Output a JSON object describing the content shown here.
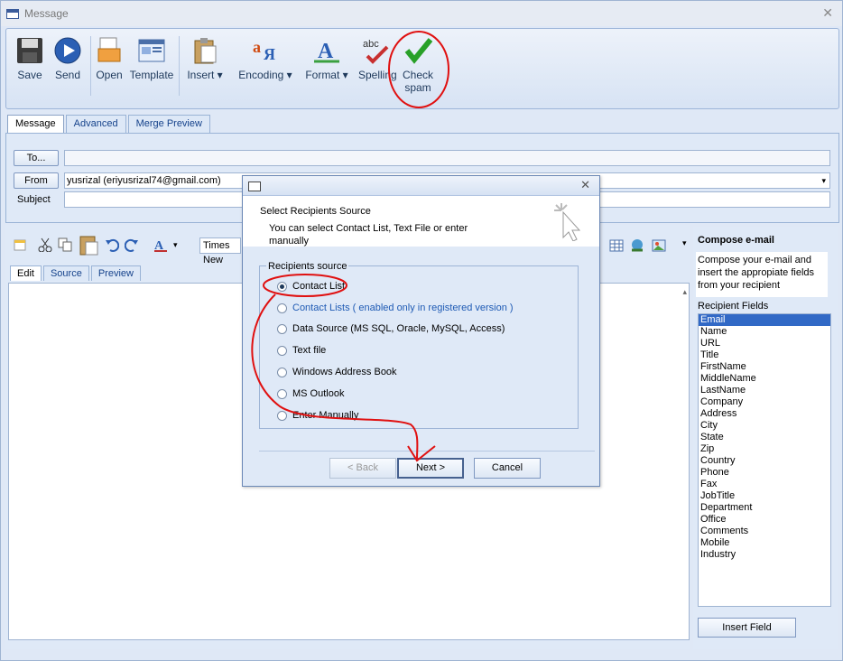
{
  "window": {
    "title": "Message",
    "close": "✕"
  },
  "ribbon": {
    "buttons": [
      {
        "label": "Save"
      },
      {
        "label": "Send"
      },
      {
        "label": "Open"
      },
      {
        "label": "Template"
      },
      {
        "label": "Insert ▾"
      },
      {
        "label": "Encoding ▾"
      },
      {
        "label": "Format ▾"
      },
      {
        "label": "Spelling"
      },
      {
        "label": "Check\nspam"
      }
    ]
  },
  "tabs": [
    "Message",
    "Advanced",
    "Merge Preview"
  ],
  "header": {
    "to_button": "To...",
    "to_value": "",
    "from_button": "From",
    "from_value": "yusrizal (eriyusrizal74@gmail.com)",
    "subject_label": "Subject",
    "subject_value": ""
  },
  "editor": {
    "font_name": "Times New",
    "tabs": [
      "Edit",
      "Source",
      "Preview"
    ]
  },
  "side": {
    "title": "Compose e-mail",
    "description": "Compose your e-mail and insert the appropiate fields from your recipient",
    "fields_label": "Recipient Fields",
    "fields": [
      "Email",
      "Name",
      "URL",
      "Title",
      "FirstName",
      "MiddleName",
      "LastName",
      "Company",
      "Address",
      "City",
      "State",
      "Zip",
      "Country",
      "Phone",
      "Fax",
      "JobTitle",
      "Department",
      "Office",
      "Comments",
      "Mobile",
      "Industry"
    ],
    "insert_button": "Insert Field"
  },
  "dialog": {
    "close": "✕",
    "heading": "Select Recipients Source",
    "subheading": "You can select Contact List, Text File or enter manually",
    "group_label": "Recipients source",
    "options": [
      {
        "label": "Contact List",
        "selected": true
      },
      {
        "label": "Contact Lists ( enabled only in registered version )",
        "selected": false
      },
      {
        "label": "Data Source (MS SQL, Oracle, MySQL, Access)",
        "selected": false
      },
      {
        "label": "Text file",
        "selected": false
      },
      {
        "label": "Windows Address Book",
        "selected": false
      },
      {
        "label": "MS Outlook",
        "selected": false
      },
      {
        "label": "Enter Manually",
        "selected": false
      }
    ],
    "back_button": "< Back",
    "next_button": "Next >",
    "cancel_button": "Cancel"
  },
  "colors": {
    "annotation": "#e01010",
    "accent": "#15428b"
  }
}
